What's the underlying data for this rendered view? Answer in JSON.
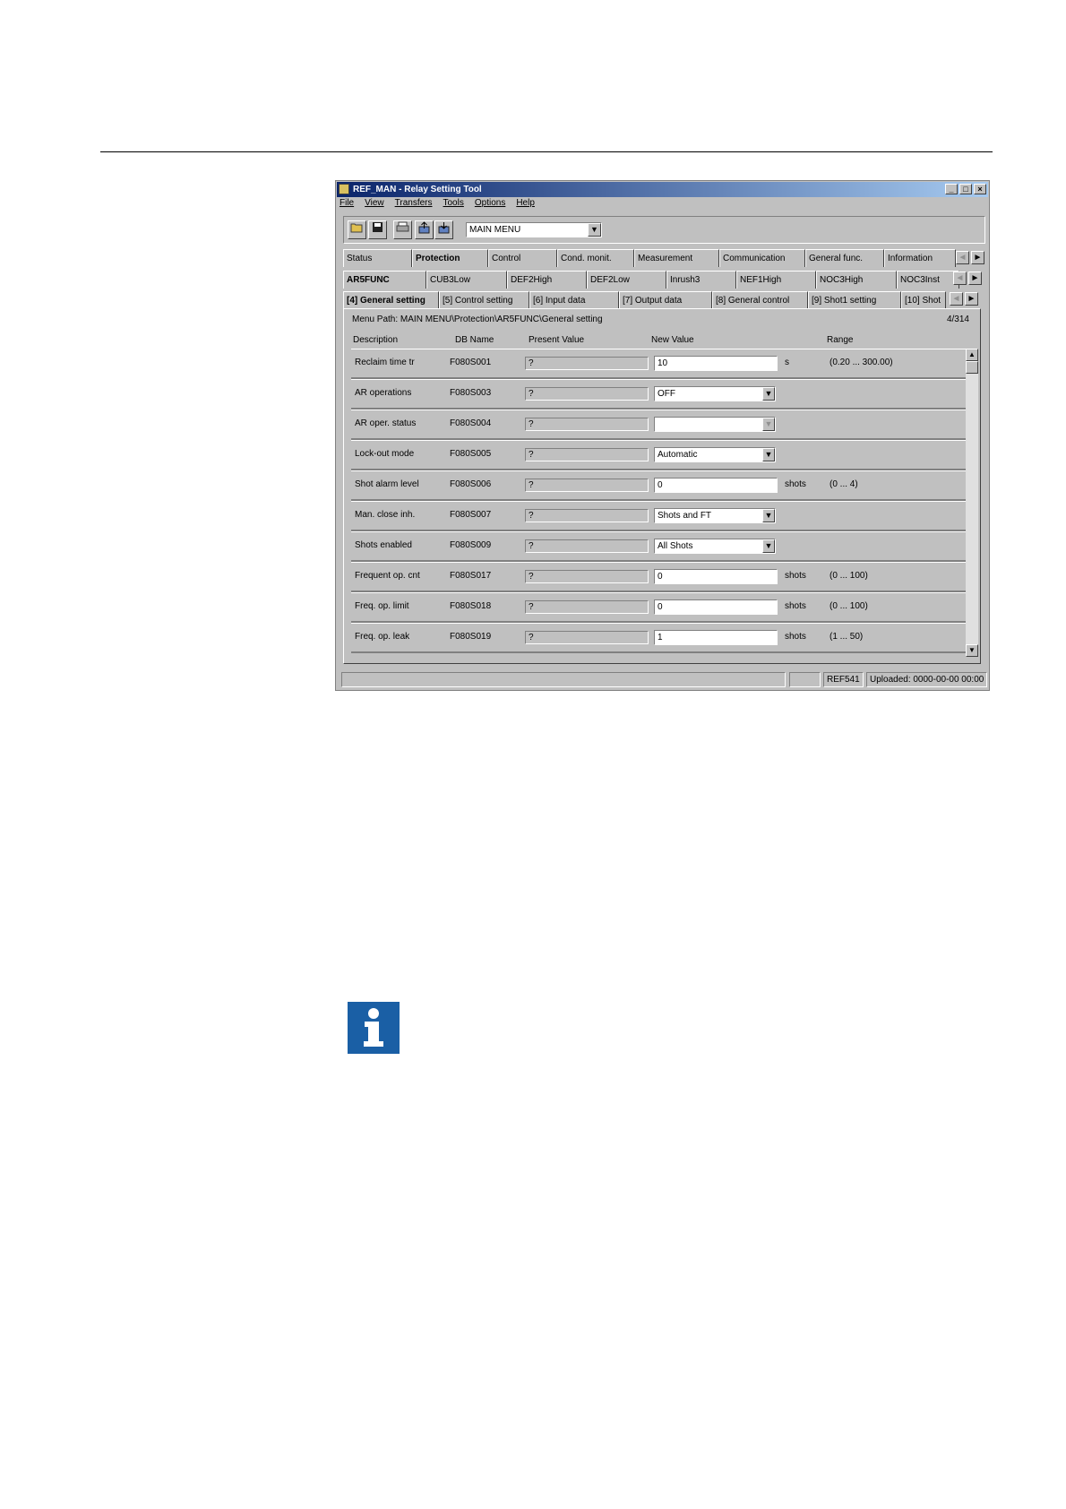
{
  "window": {
    "title": "REF_MAN - Relay Setting Tool",
    "controls": [
      "_",
      "□",
      "×"
    ]
  },
  "menu": [
    "File",
    "View",
    "Transfers",
    "Tools",
    "Options",
    "Help"
  ],
  "toolbar": {
    "buttons": [
      "open-folder-icon",
      "save-icon",
      "print-icon",
      "upload-icon",
      "download-icon"
    ],
    "menu_combo": "MAIN MENU"
  },
  "tabs_main": {
    "items": [
      "Status",
      "Protection",
      "Control",
      "Cond. monit.",
      "Measurement",
      "Communication",
      "General func.",
      "Information"
    ],
    "active": "Protection"
  },
  "tabs_func": {
    "items": [
      "AR5FUNC",
      "CUB3Low",
      "DEF2High",
      "DEF2Low",
      "Inrush3",
      "NEF1High",
      "NOC3High",
      "NOC3Inst"
    ],
    "active": "AR5FUNC"
  },
  "tabs_sub": {
    "items": [
      "[4] General setting",
      "[5] Control setting",
      "[6] Input data",
      "[7] Output data",
      "[8] General control",
      "[9] Shot1 setting",
      "[10] Shot"
    ],
    "active": "[4] General setting"
  },
  "panel": {
    "menu_path": "Menu Path:  MAIN MENU\\Protection\\AR5FUNC\\General setting",
    "count": "4/314",
    "headers": {
      "description": "Description",
      "db_name": "DB Name",
      "present_value": "Present Value",
      "new_value": "New Value",
      "range": "Range"
    },
    "rows": [
      {
        "description": "Reclaim time tr",
        "db": "F080S001",
        "present": "?",
        "new": "10",
        "type": "input",
        "unit": "s",
        "range": "(0.20 ... 300.00)"
      },
      {
        "description": "AR operations",
        "db": "F080S003",
        "present": "?",
        "new": "OFF",
        "type": "select",
        "unit": "",
        "range": ""
      },
      {
        "description": "AR oper. status",
        "db": "F080S004",
        "present": "?",
        "new": "",
        "type": "select-disabled",
        "unit": "",
        "range": ""
      },
      {
        "description": "Lock-out mode",
        "db": "F080S005",
        "present": "?",
        "new": "Automatic",
        "type": "select",
        "unit": "",
        "range": ""
      },
      {
        "description": "Shot alarm level",
        "db": "F080S006",
        "present": "?",
        "new": "0",
        "type": "input",
        "unit": "shots",
        "range": "(0 ... 4)"
      },
      {
        "description": "Man. close inh.",
        "db": "F080S007",
        "present": "?",
        "new": "Shots and FT",
        "type": "select",
        "unit": "",
        "range": ""
      },
      {
        "description": "Shots enabled",
        "db": "F080S009",
        "present": "?",
        "new": "All Shots",
        "type": "select",
        "unit": "",
        "range": ""
      },
      {
        "description": "Frequent op. cnt",
        "db": "F080S017",
        "present": "?",
        "new": "0",
        "type": "input",
        "unit": "shots",
        "range": "(0 ... 100)"
      },
      {
        "description": "Freq. op. limit",
        "db": "F080S018",
        "present": "?",
        "new": "0",
        "type": "input",
        "unit": "shots",
        "range": "(0 ... 100)"
      },
      {
        "description": "Freq. op. leak",
        "db": "F080S019",
        "present": "?",
        "new": "1",
        "type": "input",
        "unit": "shots",
        "range": "(1 ... 50)"
      }
    ]
  },
  "statusbar": {
    "device": "REF541",
    "uploaded": "Uploaded: 0000-00-00 00:00"
  },
  "note_icon": "info-icon"
}
